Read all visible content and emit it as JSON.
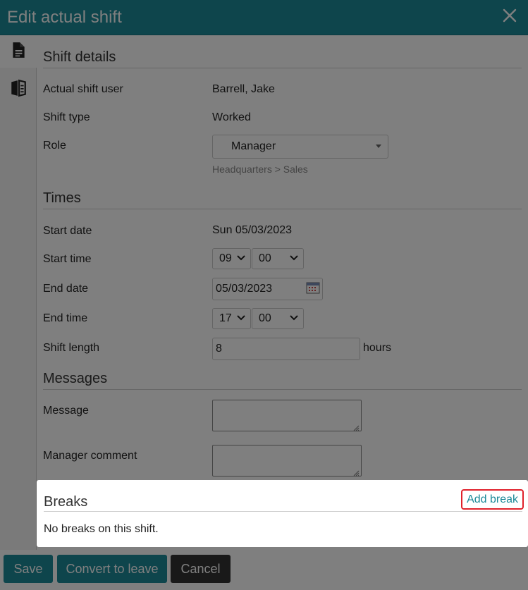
{
  "dialog": {
    "title": "Edit actual shift",
    "close_icon": "close-icon",
    "accent_color": "#1c8a99"
  },
  "rail": {
    "tabs": [
      {
        "icon": "document-icon",
        "active": true
      },
      {
        "icon": "book-icon",
        "active": false
      }
    ]
  },
  "shift_details": {
    "header": "Shift details",
    "user_label": "Actual shift user",
    "user_value": "Barrell, Jake",
    "type_label": "Shift type",
    "type_value": "Worked",
    "role_label": "Role",
    "role_value": "Manager",
    "role_path": "Headquarters > Sales"
  },
  "times": {
    "header": "Times",
    "start_date_label": "Start date",
    "start_date_value": "Sun 05/03/2023",
    "start_time_label": "Start time",
    "start_hour": "09",
    "start_minute": "00",
    "end_date_label": "End date",
    "end_date_value": "05/03/2023",
    "end_time_label": "End time",
    "end_hour": "17",
    "end_minute": "00",
    "length_label": "Shift length",
    "length_value": "8",
    "length_unit": "hours"
  },
  "messages": {
    "header": "Messages",
    "message_label": "Message",
    "manager_comment_label": "Manager comment"
  },
  "breaks": {
    "header": "Breaks",
    "add_label": "Add break",
    "empty_text": "No breaks on this shift."
  },
  "footer": {
    "save_label": "Save",
    "convert_label": "Convert to leave",
    "cancel_label": "Cancel"
  }
}
